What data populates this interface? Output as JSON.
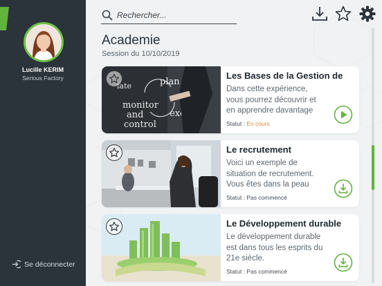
{
  "sidebar": {
    "user_name": "Lucille KERIM",
    "company": "Serious Factory",
    "logout_label": "Se déconnecter",
    "accent_color": "#62b33b",
    "background_color": "#2b333b"
  },
  "toolbar": {
    "search_placeholder": "Rechercher...",
    "icons": [
      "download-icon",
      "star-icon",
      "gear-icon"
    ]
  },
  "page": {
    "title": "Academie",
    "subtitle": "Session du 10/10/2019"
  },
  "cards": [
    {
      "title": "Les Bases de la Gestion de",
      "description": "Dans cette expérience, vous pourrez découvrir et en apprendre davantage",
      "status_label": "Statut : ",
      "status_value": "En cours",
      "action": "play-icon"
    },
    {
      "title": "Le recrutement",
      "description": "Voici un exemple de situation de recrutement. Vous êtes dans la peau",
      "status_label": "Statut : ",
      "status_value": "Pas commencé",
      "action": "download-icon"
    },
    {
      "title": "Le Développement durable",
      "description": "Le développement durable est dans tous les esprits du 21e siècle.",
      "status_label": "Statut : ",
      "status_value": "Pas commencé",
      "action": "download-icon"
    }
  ],
  "colors": {
    "accent": "#62b33b",
    "in_progress": "#e8843a"
  }
}
